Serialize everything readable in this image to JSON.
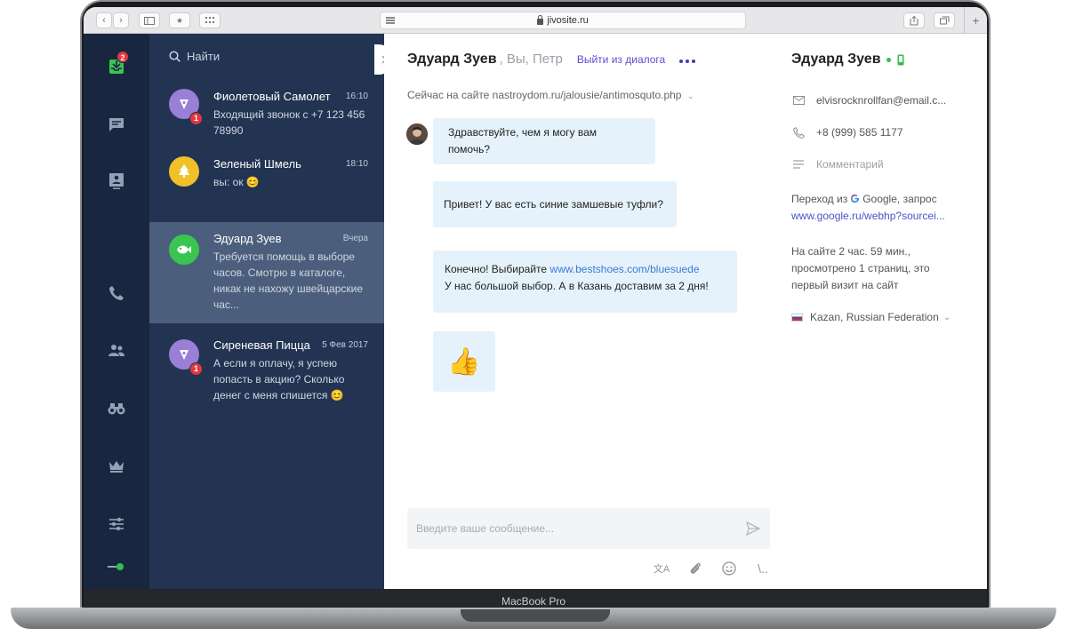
{
  "browser": {
    "url": "jivosite.ru"
  },
  "device": {
    "label": "MacBook Pro"
  },
  "rail": {
    "inbox_badge": "2"
  },
  "search": {
    "label": "Найти"
  },
  "chats": [
    {
      "name": "Фиолетовый Самолет",
      "time": "16:10",
      "text": "Входящий звонок с +7 123 456 78990",
      "unread": "1",
      "avatar_color": "#9a7fd6"
    },
    {
      "name": "Зеленый Шмель",
      "time": "18:10",
      "text": "вы: ок 😊",
      "unread": "",
      "avatar_color": "#f1c12b"
    },
    {
      "name": "Эдуард Зуев",
      "time": "Вчера",
      "text": "Требуется помощь в выборе часов. Смотрю в каталоге, никак не нахожу швейцарские час...",
      "unread": "",
      "avatar_color": "#3ac551"
    },
    {
      "name": "Сиреневая Пицца",
      "time": "5 Фев 2017",
      "text": "А если я оплачу, я успею попасть в акцию? Сколько денег с меня спишется 😊",
      "unread": "1",
      "avatar_color": "#9a7fd6"
    }
  ],
  "conversation": {
    "title": "Эдуард Зуев",
    "participants": ", Вы, Петр",
    "leave_label": "Выйти из диалога",
    "now_on_site": "Сейчас на сайте nastroydom.ru/jalousie/antimosquto.php",
    "messages": [
      {
        "text": "Здравствуйте, чем я могу вам помочь?"
      },
      {
        "text": "Привет! У вас есть синие замшевые туфли?"
      },
      {
        "prefix": "Конечно! Выбирайте ",
        "link": "www.bestshoes.com/bluesuede",
        "line2": "У нас большой выбор. А в Казань доставим за 2 дня!"
      },
      {
        "emoji": "👍"
      }
    ],
    "input_placeholder": "Введите ваше сообщение...",
    "tools": {
      "translate": "文A",
      "more": "\\.."
    }
  },
  "visitor": {
    "name": "Эдуард Зуев",
    "email": "elvisrocknrollfan@email.c...",
    "phone": "+8 (999) 585 1177",
    "comment_placeholder": "Комментарий",
    "referral_prefix": "Переход из",
    "referral_source": "Google, запрос",
    "referral_link": "www.google.ru/webhp?sourcei...",
    "visit_info": "На сайте 2 час. 59 мин., просмотрено 1 страниц, это первый визит на сайт",
    "location": "Kazan, Russian Federation"
  },
  "colors": {
    "rail_bg": "#192640",
    "list_bg": "#223452",
    "active_bg": "#4b5f7d",
    "bubble_bg": "#e5f2fb",
    "online": "#2fbf4f",
    "badge": "#e1373f"
  }
}
